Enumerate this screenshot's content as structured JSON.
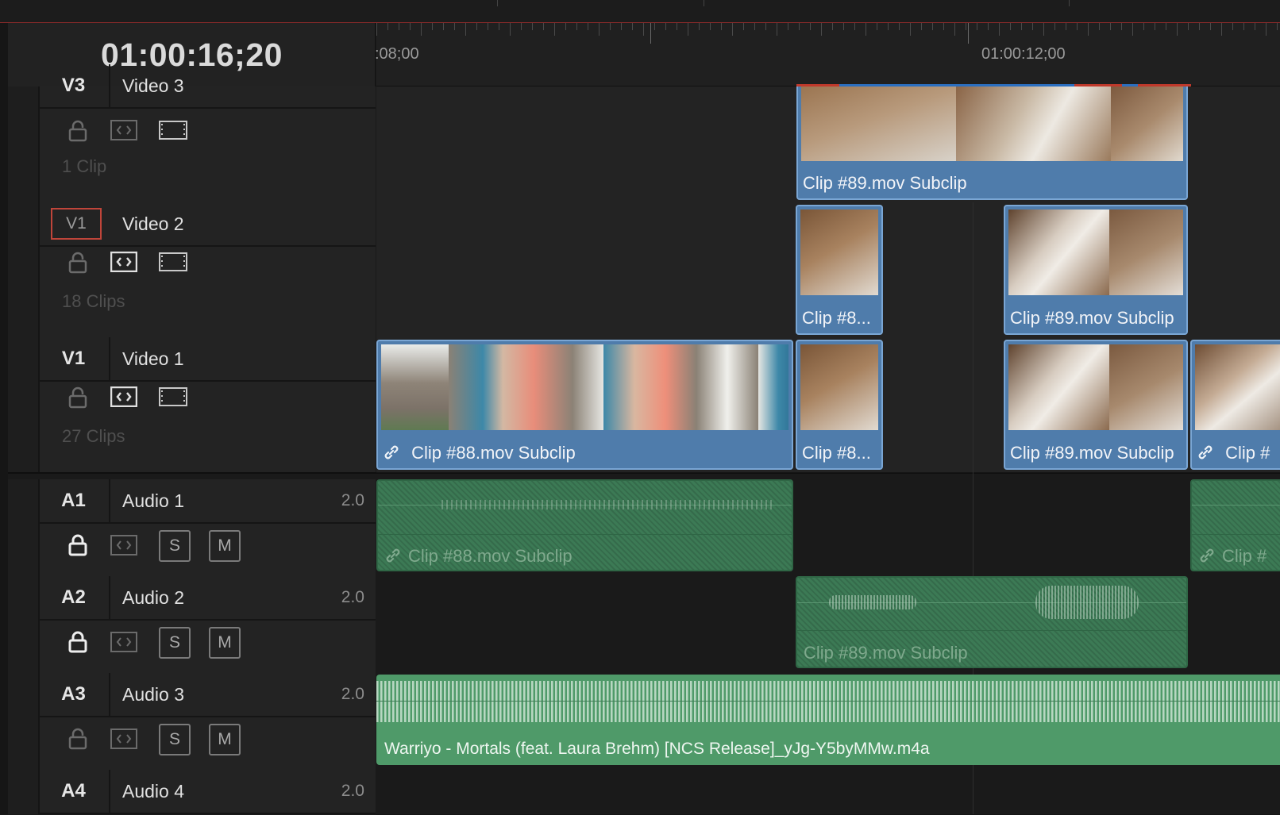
{
  "timecode": "01:00:16;20",
  "ruler": {
    "labels": [
      ":08;00",
      "01:00:12;00"
    ]
  },
  "tracks": {
    "v3": {
      "id": "V3",
      "name": "Video 3",
      "count": "1 Clip"
    },
    "v2": {
      "id": "V1",
      "name": "Video 2",
      "count": "18 Clips"
    },
    "v1": {
      "id": "V1",
      "name": "Video 1",
      "count": "27 Clips"
    },
    "a1": {
      "id": "A1",
      "name": "Audio 1",
      "channels": "2.0"
    },
    "a2": {
      "id": "A2",
      "name": "Audio 2",
      "channels": "2.0"
    },
    "a3": {
      "id": "A3",
      "name": "Audio 3",
      "channels": "2.0"
    },
    "a4": {
      "id": "A4",
      "name": "Audio 4",
      "channels": "2.0"
    }
  },
  "buttons": {
    "solo": "S",
    "mute": "M"
  },
  "clips": {
    "v3_1": "Clip #89.mov Subclip",
    "v2_1": "Clip #8...",
    "v2_2": "Clip #89.mov Subclip",
    "v1_1": "Clip #88.mov Subclip",
    "v1_2": "Clip #8...",
    "v1_3": "Clip #89.mov Subclip",
    "v1_4": "Clip #",
    "a1_1": "Clip #88.mov Subclip",
    "a1_2": "Clip #",
    "a2_1": "Clip #89.mov Subclip",
    "a3_1": "Warriyo - Mortals (feat. Laura Brehm) [NCS Release]_yJg-Y5byMMw.m4a"
  },
  "colors": {
    "video_clip": "#4f7cab",
    "audio_clip": "#3c7a55",
    "music_clip": "#4f9a69",
    "target_badge": "#c0453a",
    "playhead": "#8a2a2a"
  },
  "icons": [
    "lock-icon",
    "auto-select-icon",
    "track-output-icon",
    "link-icon"
  ]
}
